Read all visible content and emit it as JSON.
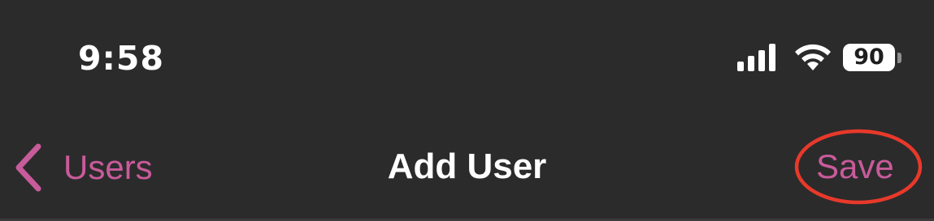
{
  "status_bar": {
    "time": "9:58",
    "signal_icon": "cellular-signal-icon",
    "wifi_icon": "wifi-icon",
    "battery_level": "90"
  },
  "nav_bar": {
    "back_icon": "chevron-left-icon",
    "back_label": "Users",
    "title": "Add User",
    "save_label": "Save",
    "annotation": "red-circle-highlight"
  },
  "colors": {
    "background": "#2b2b2c",
    "accent": "#c85b9a",
    "annotation": "#e8392a",
    "text": "#ffffff"
  }
}
